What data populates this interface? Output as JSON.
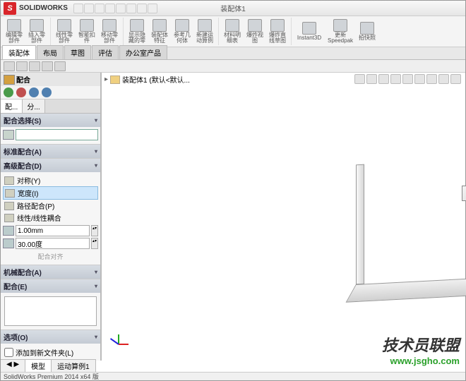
{
  "title": {
    "brand": "SOLIDWORKS",
    "doc": "装配体1"
  },
  "ribbon": [
    {
      "label": "编辑零\n部件"
    },
    {
      "label": "插入零\n部件"
    },
    {
      "label": "线性零\n部件"
    },
    {
      "label": "智能扣\n件"
    },
    {
      "label": "移动零\n部件"
    },
    {
      "label": "显示隐\n藏的零"
    },
    {
      "label": "装配体\n特征"
    },
    {
      "label": "参考几\n何体"
    },
    {
      "label": "新建运\n动算例"
    },
    {
      "label": "材料明\n细表"
    },
    {
      "label": "爆炸视\n图"
    },
    {
      "label": "爆炸直\n线草图"
    },
    {
      "label": "Instant3D"
    },
    {
      "label": "更新\nSpeedpak"
    },
    {
      "label": "拍快照"
    }
  ],
  "doctabs": [
    "装配体",
    "布局",
    "草图",
    "评估",
    "办公室产品"
  ],
  "tree": {
    "root": "装配体1  (默认<默认..."
  },
  "pm": {
    "title": "配合",
    "tabs": [
      "配...",
      "分..."
    ],
    "sections": {
      "sel": {
        "h": "配合选择(S)"
      },
      "std": {
        "h": "标准配合(A)"
      },
      "adv": {
        "h": "高级配合(D)",
        "rows": [
          {
            "l": "对称(Y)"
          },
          {
            "l": "宽度(I)"
          },
          {
            "l": "路径配合(P)"
          },
          {
            "l": "线性/线性耦合"
          }
        ],
        "dim1": "1.00mm",
        "dim2": "30.00度",
        "note": "配合对齐"
      },
      "mech": {
        "h": "机械配合(A)"
      },
      "mates": {
        "h": "配合(E)"
      },
      "opts": {
        "h": "选项(O)",
        "chk": "添加到新文件夹(L)"
      }
    }
  },
  "btabs": [
    "模型",
    "运动算例1"
  ],
  "status": "SolidWorks Premium 2014 x64 版",
  "watermark": {
    "t1": "技术员联盟",
    "t2": "www.jsgho.com"
  }
}
